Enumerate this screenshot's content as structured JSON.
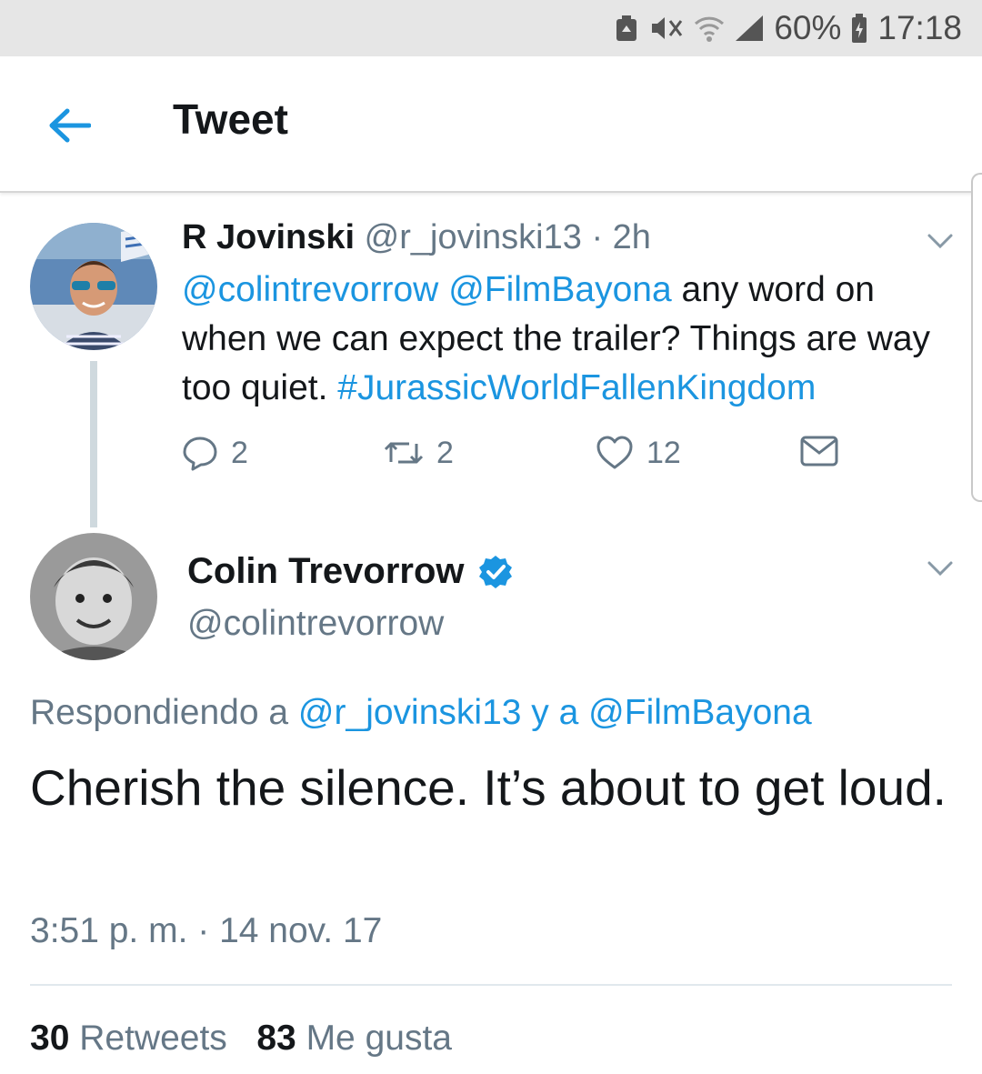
{
  "status_bar": {
    "battery_percent": "60%",
    "time": "17:18",
    "icons": [
      "recycle-battery-icon",
      "mute-icon",
      "wifi-icon",
      "signal-icon",
      "battery-icon"
    ]
  },
  "toolbar": {
    "title": "Tweet",
    "back_icon": "arrow-left-icon",
    "accent_color": "#1b95e0"
  },
  "parent_tweet": {
    "name": "R Jovinski",
    "handle": "@r_jovinski13",
    "separator": "·",
    "time_ago": "2h",
    "mention_1": "@colintrevorrow",
    "mention_2": "@FilmBayona",
    "text_part": " any word on when we can expect the trailer? Things are way too quiet. ",
    "hashtag": "#JurassicWorldFallenKingdom",
    "replies": "2",
    "retweets": "2",
    "likes": "12"
  },
  "main_tweet": {
    "name": "Colin Trevorrow",
    "handle": "@colintrevorrow",
    "verified_icon": "verified-badge-icon",
    "replying_prefix": "Respondiendo a",
    "replying_user1": "@r_jovinski13",
    "replying_join": "y a",
    "replying_user2": "@FilmBayona",
    "text": "Cherish the silence. It’s about to get loud.",
    "timestamp": "3:51 p. m. · 14 nov. 17",
    "retweet_count": "30",
    "retweet_label": "Retweets",
    "like_count": "83",
    "like_label": "Me gusta"
  }
}
